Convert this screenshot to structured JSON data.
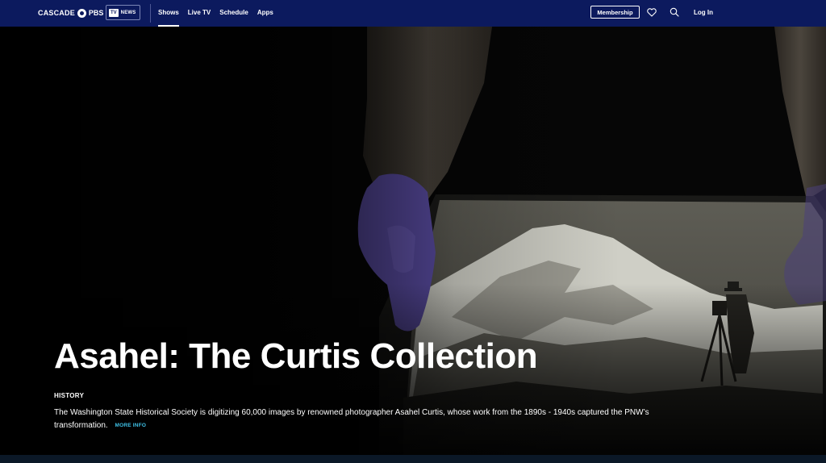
{
  "nav": {
    "brand_cascade": "CASCADE",
    "brand_pbs": "PBS",
    "tv_label": "TV",
    "news_label": "NEWS",
    "links": [
      "Shows",
      "Live TV",
      "Schedule",
      "Apps"
    ],
    "active_link": "Shows",
    "membership_label": "Membership",
    "login_label": "Log In",
    "icons": [
      "heart-icon",
      "search-icon"
    ]
  },
  "hero": {
    "title": "Asahel: The Curtis Collection",
    "genre": "HISTORY",
    "description": "The Washington State Historical Society is digitizing 60,000 images by renowned photographer Asahel Curtis, whose work from the 1890s - 1940s captured the PNW’s transformation.",
    "more_info_label": "MORE INFO"
  },
  "colors": {
    "nav_bg": "#0c1a5e",
    "accent_link": "#3fc2e8",
    "glove": "#5c4ea6"
  }
}
